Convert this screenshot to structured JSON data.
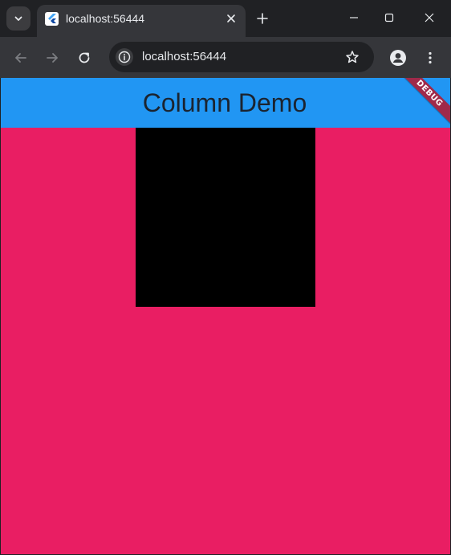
{
  "tab": {
    "title": "localhost:56444"
  },
  "omnibox": {
    "url": "localhost:56444"
  },
  "app": {
    "title": "Column Demo",
    "debug_label": "DEBUG"
  },
  "colors": {
    "page_background": "#e91e63",
    "appbar": "#2196f3",
    "box": "#000000",
    "debug_banner": "#a0294a"
  }
}
